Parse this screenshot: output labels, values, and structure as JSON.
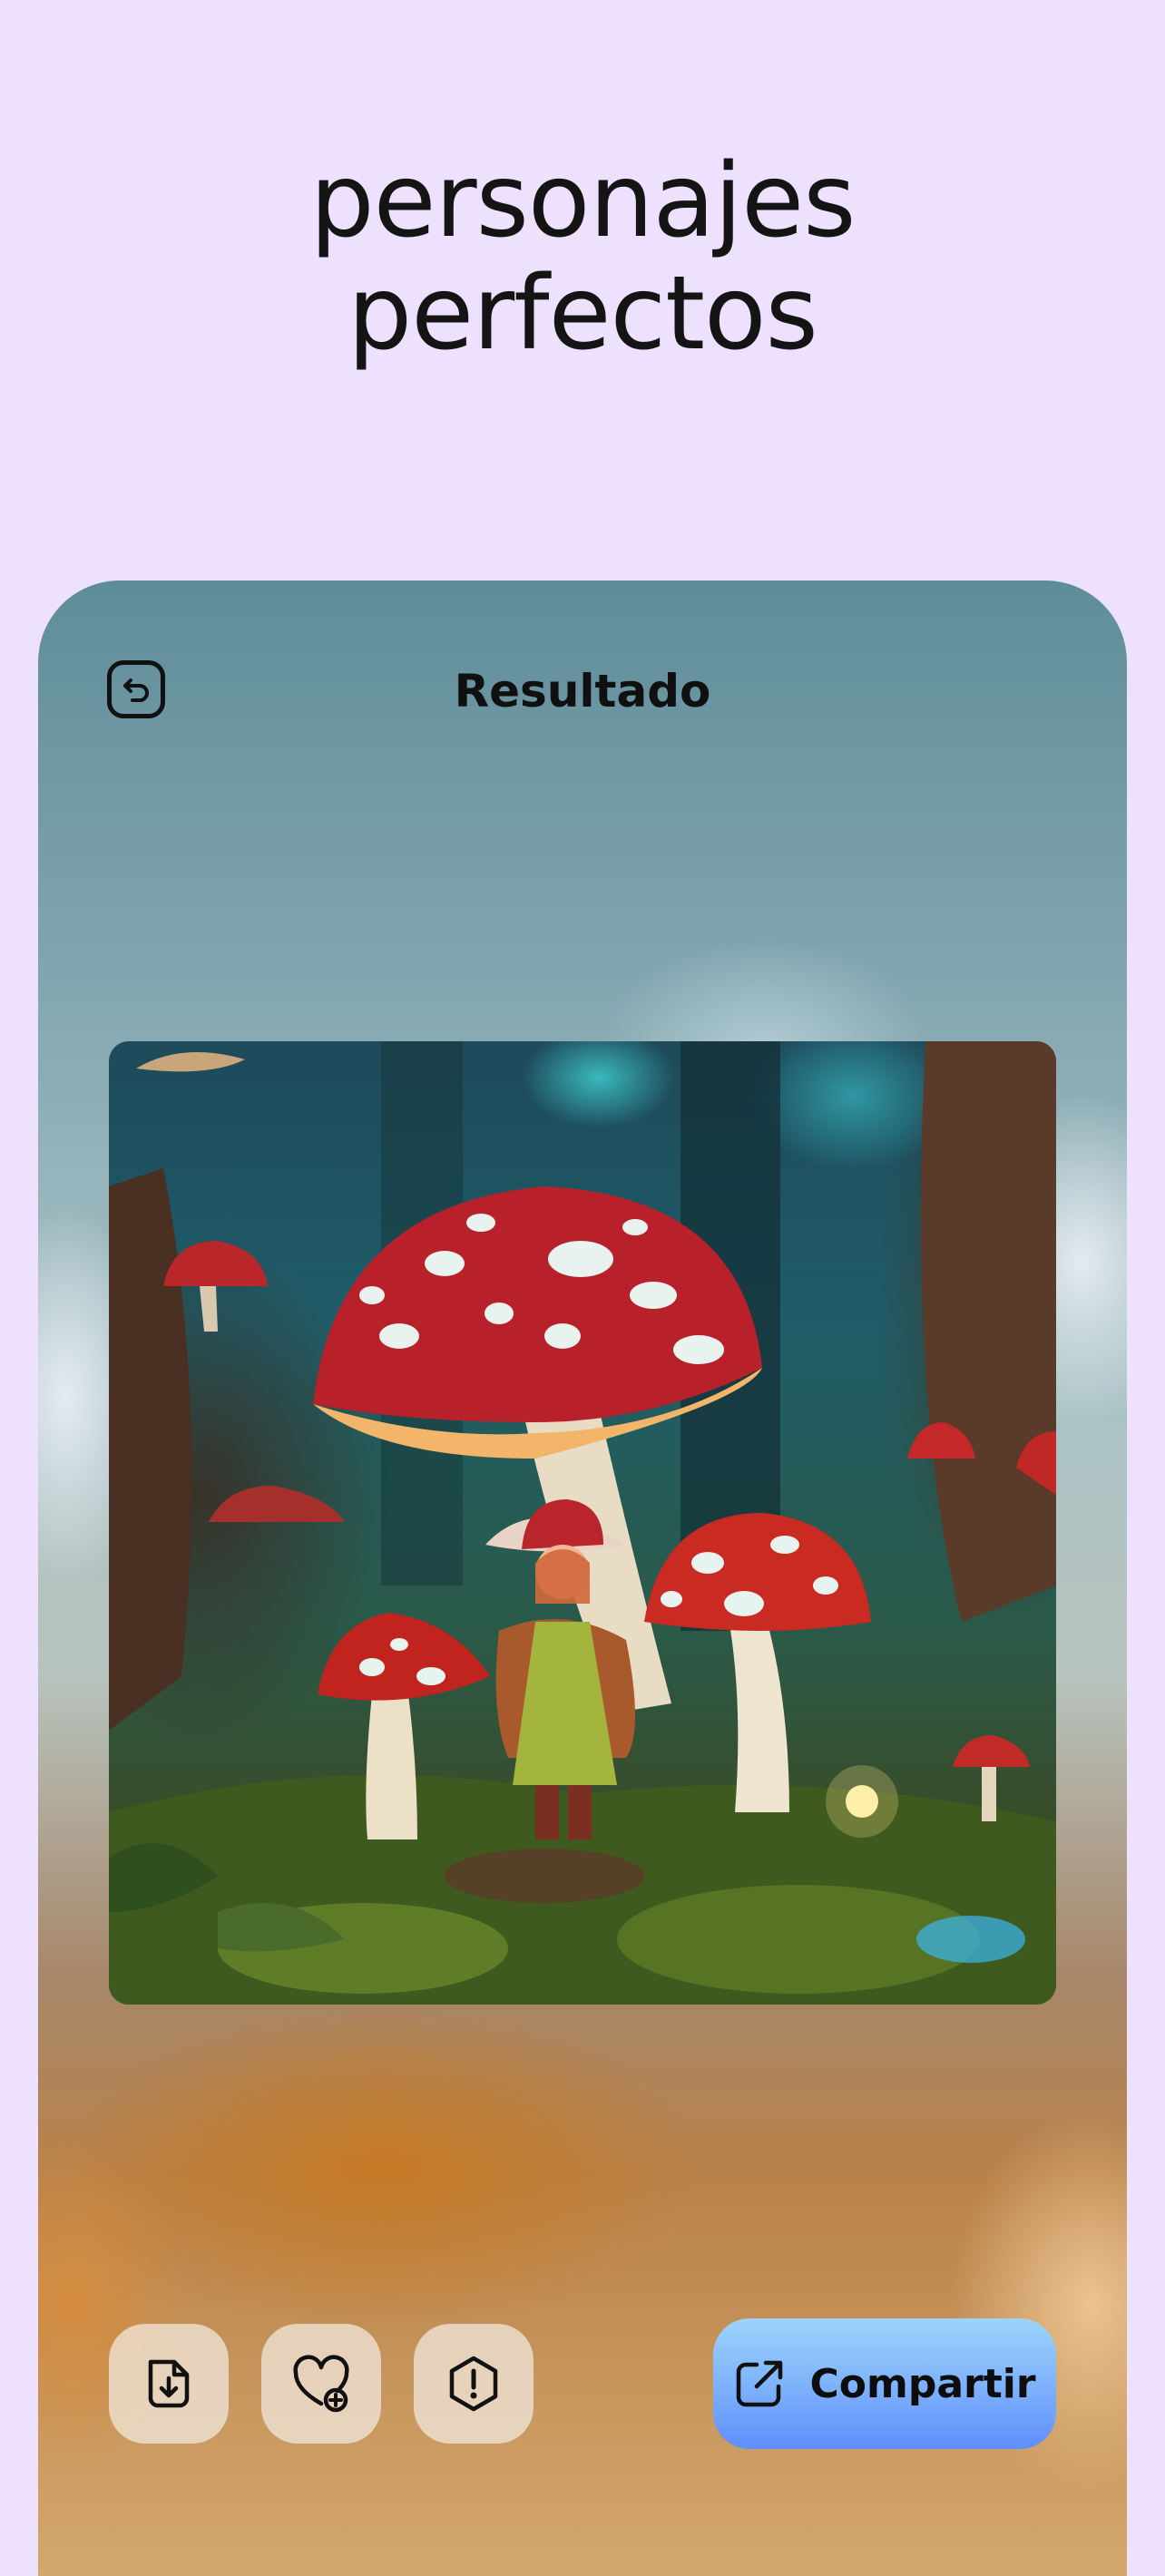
{
  "hero": {
    "line1": "personajes",
    "line2": "perfectos"
  },
  "screen": {
    "title": "Resultado",
    "back_icon": "back-arrow-icon"
  },
  "image": {
    "alt": "Personaje de fantasía con sombrero entre setas gigantes en un bosque"
  },
  "actions": {
    "download_icon": "download-file-icon",
    "favorite_icon": "heart-add-icon",
    "report_icon": "warning-octagon-icon",
    "share_label": "Compartir",
    "share_icon": "external-share-icon"
  },
  "colors": {
    "background": "#ede1fe",
    "share_gradient_top": "#9dd4fb",
    "share_gradient_bottom": "#5f8ffb"
  }
}
